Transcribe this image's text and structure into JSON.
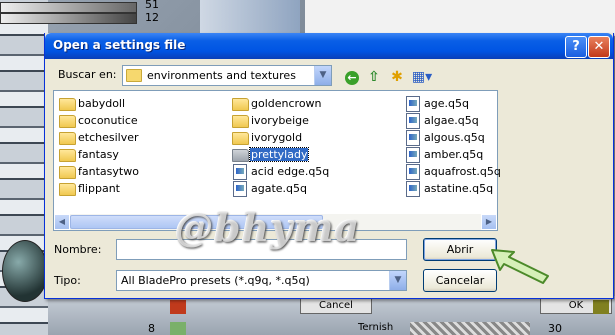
{
  "background": {
    "numbers": [
      "51",
      "12"
    ],
    "buttons": [
      "Cancel",
      "OK"
    ],
    "bottom_label": "Ternish",
    "bottom_values": [
      "8",
      "30"
    ]
  },
  "dialog": {
    "title": "Open a settings file",
    "help_button": "?",
    "close_button": "✕",
    "look_in_label": "Buscar en:",
    "look_in_value": "environments and textures",
    "files": [
      {
        "name": "babydoll",
        "type": "folder"
      },
      {
        "name": "coconutice",
        "type": "folder"
      },
      {
        "name": "etchesilver",
        "type": "folder"
      },
      {
        "name": "fantasy",
        "type": "folder"
      },
      {
        "name": "fantasytwo",
        "type": "folder"
      },
      {
        "name": "flippant",
        "type": "folder"
      },
      {
        "name": "goldencrown",
        "type": "folder"
      },
      {
        "name": "ivorybeige",
        "type": "folder"
      },
      {
        "name": "ivorygold",
        "type": "folder"
      },
      {
        "name": "prettylady",
        "type": "folder",
        "selected": true
      },
      {
        "name": "acid edge.q5q",
        "type": "file"
      },
      {
        "name": "agate.q5q",
        "type": "file"
      },
      {
        "name": "age.q5q",
        "type": "file"
      },
      {
        "name": "algae.q5q",
        "type": "file"
      },
      {
        "name": "algous.q5q",
        "type": "file"
      },
      {
        "name": "amber.q5q",
        "type": "file"
      },
      {
        "name": "aquafrost.q5q",
        "type": "file"
      },
      {
        "name": "astatine.q5q",
        "type": "file"
      }
    ],
    "filename_label": "Nombre:",
    "filename_value": "",
    "filetype_label": "Tipo:",
    "filetype_value": "All BladePro presets (*.q9q, *.q5q)",
    "open_button": "Abrir",
    "cancel_button": "Cancelar",
    "colors": {
      "title_blue": "#0054e3",
      "selection": "#316ac5",
      "dialog_bg": "#ece9d8"
    }
  },
  "watermark": "@bhyma"
}
